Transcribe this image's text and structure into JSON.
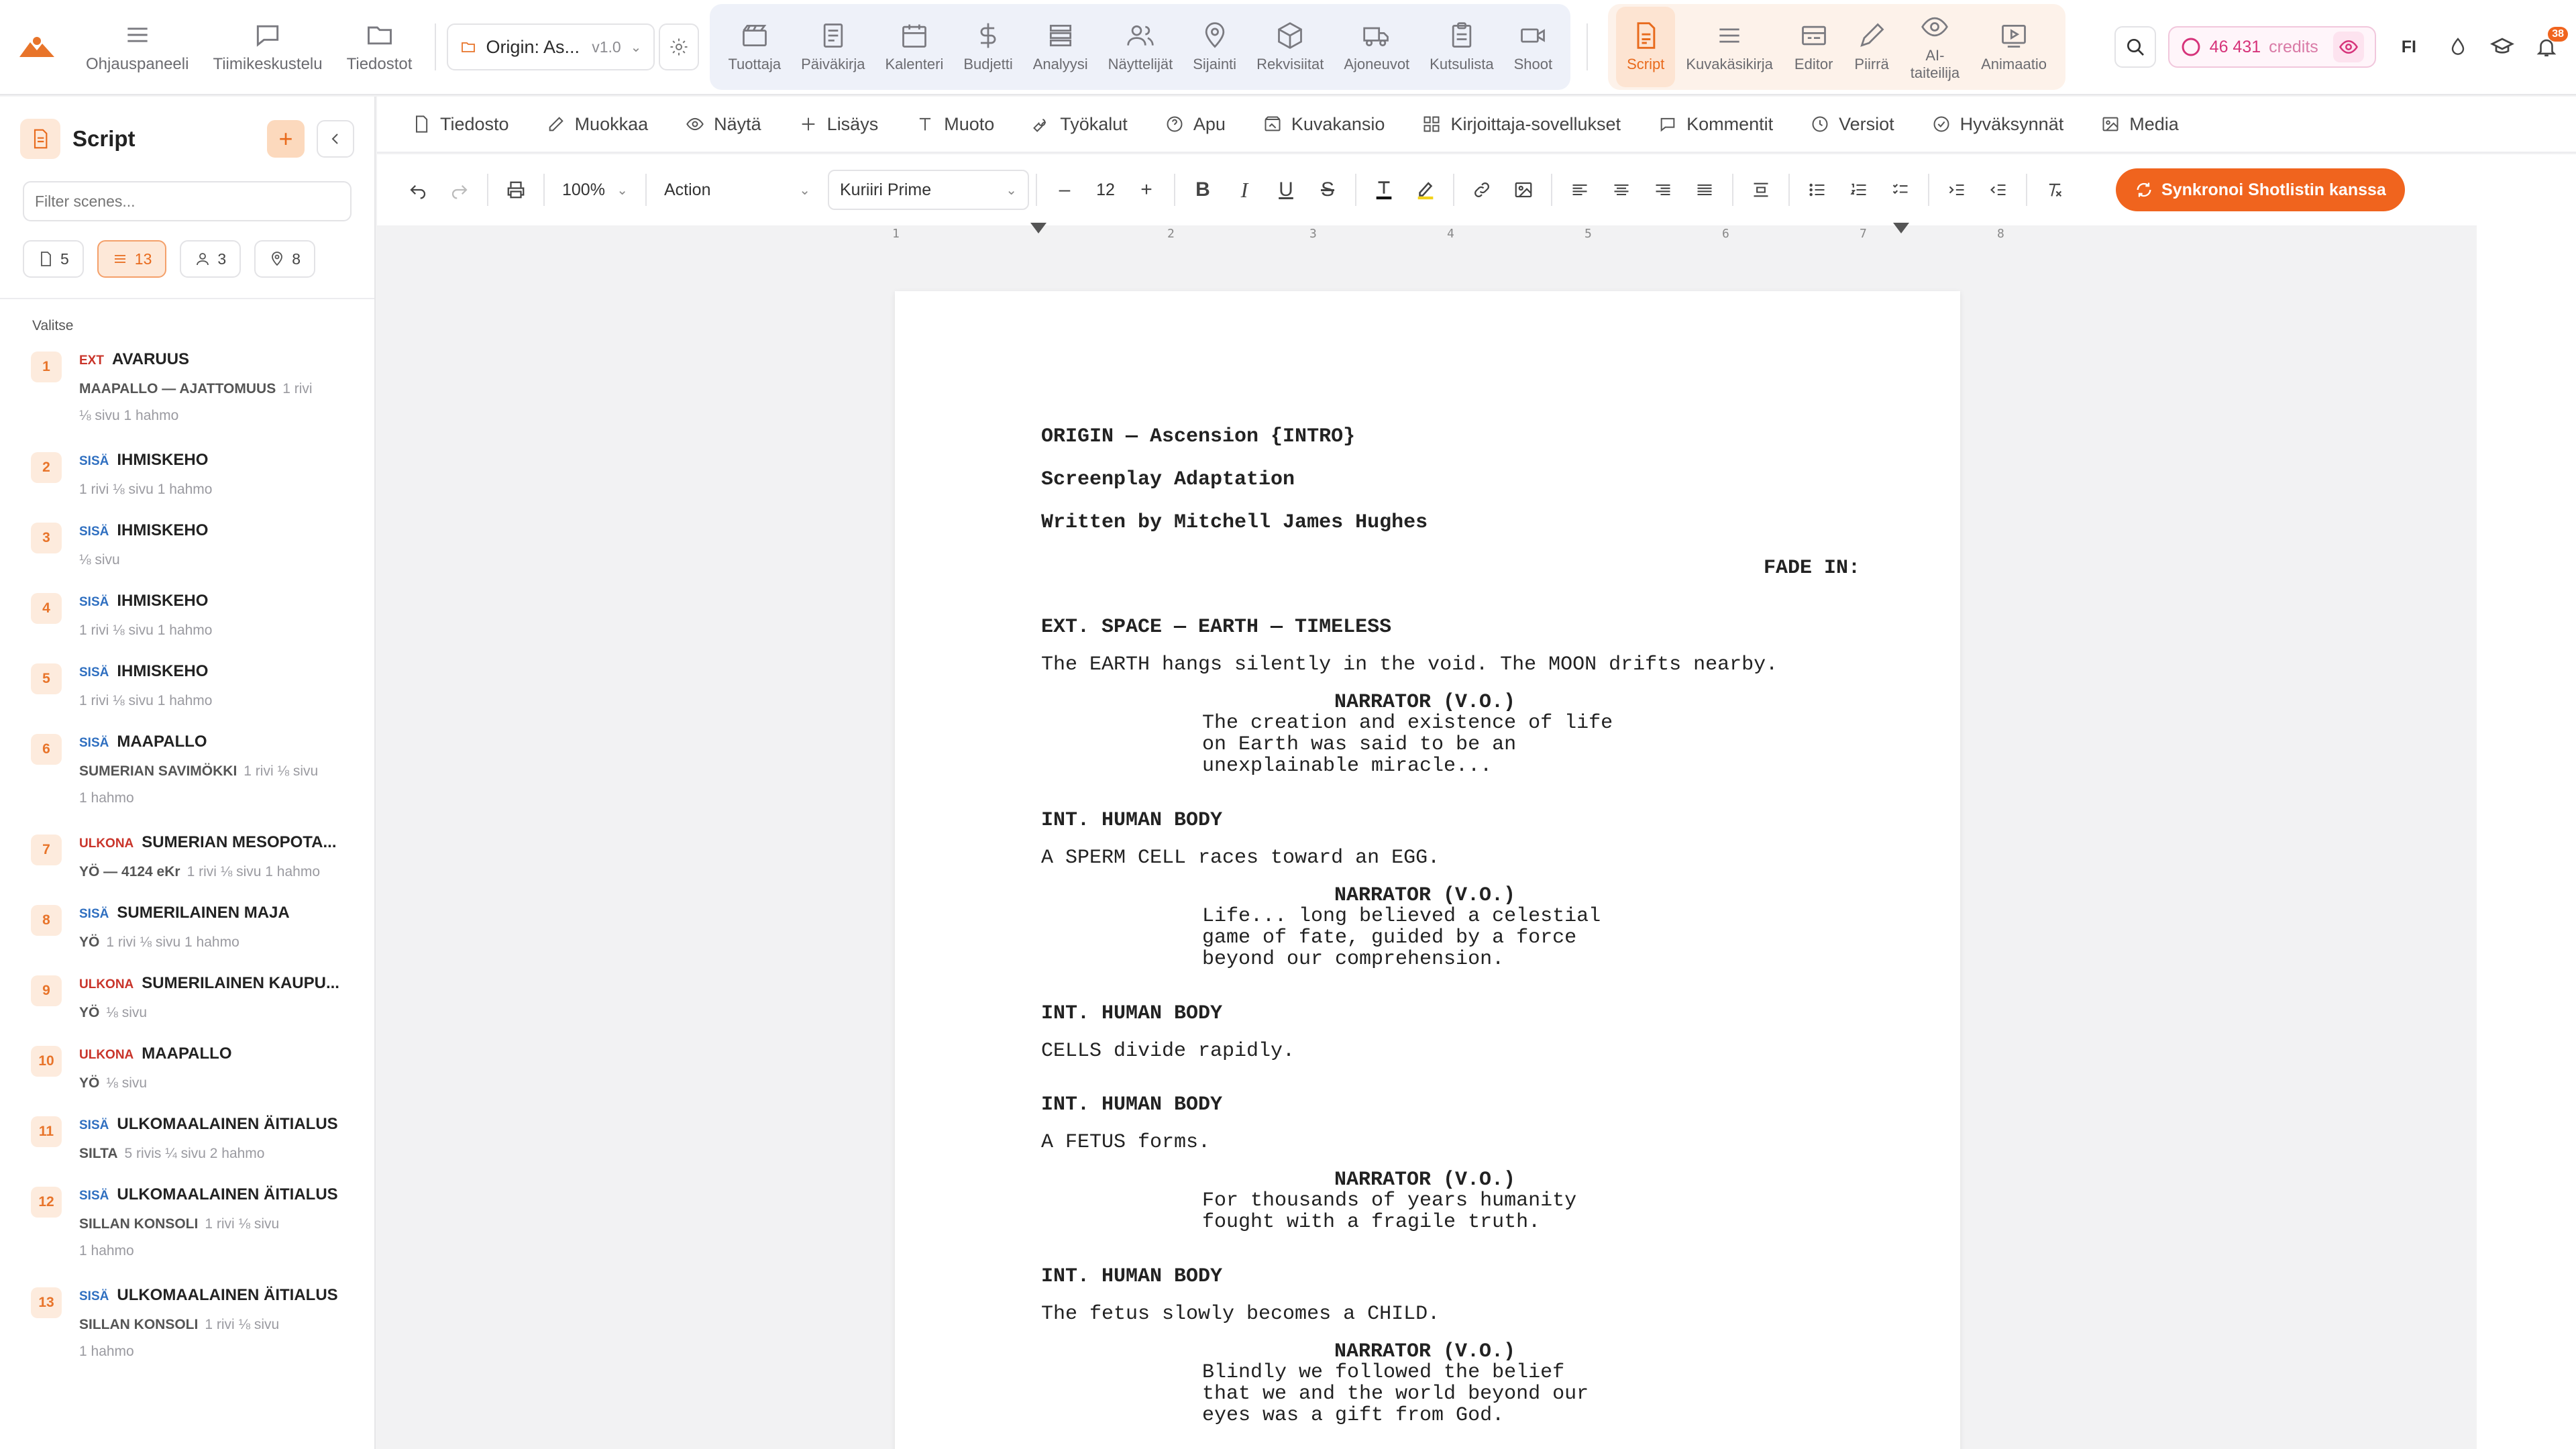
{
  "topbar": {
    "nav": [
      {
        "label": "Ohjauspaneeli",
        "icon": "dashboard-icon"
      },
      {
        "label": "Tiimikeskustelu",
        "icon": "chat-icon"
      },
      {
        "label": "Tiedostot",
        "icon": "folder-icon"
      }
    ],
    "project": {
      "name": "Origin: As...",
      "version": "v1.0"
    },
    "production_tools": [
      {
        "label": "Tuottaja",
        "icon": "clapper-icon"
      },
      {
        "label": "Päiväkirja",
        "icon": "journal-icon"
      },
      {
        "label": "Kalenteri",
        "icon": "calendar-icon"
      },
      {
        "label": "Budjetti",
        "icon": "dollar-icon"
      },
      {
        "label": "Analyysi",
        "icon": "layers-icon"
      },
      {
        "label": "Näyttelijät",
        "icon": "people-icon"
      },
      {
        "label": "Sijainti",
        "icon": "pin-icon"
      },
      {
        "label": "Rekvisiitat",
        "icon": "box-icon"
      },
      {
        "label": "Ajoneuvot",
        "icon": "truck-icon"
      },
      {
        "label": "Kutsulista",
        "icon": "clipboard-icon"
      },
      {
        "label": "Shoot",
        "icon": "camera-icon"
      }
    ],
    "creative_tools": [
      {
        "label": "Script",
        "icon": "script-icon",
        "active": true
      },
      {
        "label": "Kuvakäsikirja",
        "icon": "list-icon"
      },
      {
        "label": "Editor",
        "icon": "editor-icon"
      },
      {
        "label": "Piirrä",
        "icon": "pencil-icon"
      },
      {
        "label": "AI-\ntaiteilija",
        "icon": "eye-icon"
      },
      {
        "label": "Animaatio",
        "icon": "play-icon"
      }
    ],
    "credits": {
      "amount": "46 431",
      "unit": "credits"
    },
    "language": "FI",
    "notifications": "38"
  },
  "sidebar": {
    "title": "Script",
    "filter_placeholder": "Filter scenes...",
    "stats": [
      {
        "value": "5",
        "icon": "page-icon"
      },
      {
        "value": "13",
        "icon": "list-icon",
        "active": true
      },
      {
        "value": "3",
        "icon": "person-icon"
      },
      {
        "value": "8",
        "icon": "pin-icon"
      }
    ],
    "select_label": "Valitse",
    "scenes": [
      {
        "num": "1",
        "type": "EXT",
        "kind": "ext",
        "heading": "AVARUUS",
        "loc": "MAAPALLO — AJATTOMUUS",
        "meta1": "1 rivi",
        "meta2": "⅛ sivu  1 hahmo"
      },
      {
        "num": "2",
        "type": "SISÄ",
        "kind": "int",
        "heading": "IHMISKEHO",
        "loc": "",
        "meta1": "1 rivi  ⅛ sivu  1 hahmo",
        "meta2": ""
      },
      {
        "num": "3",
        "type": "SISÄ",
        "kind": "int",
        "heading": "IHMISKEHO",
        "loc": "",
        "meta1": "⅛ sivu",
        "meta2": ""
      },
      {
        "num": "4",
        "type": "SISÄ",
        "kind": "int",
        "heading": "IHMISKEHO",
        "loc": "",
        "meta1": "1 rivi  ⅛ sivu  1 hahmo",
        "meta2": ""
      },
      {
        "num": "5",
        "type": "SISÄ",
        "kind": "int",
        "heading": "IHMISKEHO",
        "loc": "",
        "meta1": "1 rivi  ⅛ sivu  1 hahmo",
        "meta2": ""
      },
      {
        "num": "6",
        "type": "SISÄ",
        "kind": "int",
        "heading": "MAAPALLO",
        "loc": "SUMERIAN SAVIMÖKKI",
        "meta1": "1 rivi  ⅛ sivu",
        "meta2": "1 hahmo"
      },
      {
        "num": "7",
        "type": "ULKONA",
        "kind": "ext",
        "heading": "SUMERIAN MESOPOTA...",
        "loc": "YÖ — 4124 eKr",
        "meta1": "1 rivi  ⅛ sivu  1 hahmo",
        "meta2": ""
      },
      {
        "num": "8",
        "type": "SISÄ",
        "kind": "int",
        "heading": "SUMERILAINEN MAJA",
        "loc": "YÖ",
        "meta1": "1 rivi  ⅛ sivu  1 hahmo",
        "meta2": ""
      },
      {
        "num": "9",
        "type": "ULKONA",
        "kind": "ext",
        "heading": "SUMERILAINEN KAUPU...",
        "loc": "YÖ",
        "meta1": "⅛ sivu",
        "meta2": ""
      },
      {
        "num": "10",
        "type": "ULKONA",
        "kind": "ext",
        "heading": "MAAPALLO",
        "loc": "YÖ",
        "meta1": "⅛ sivu",
        "meta2": ""
      },
      {
        "num": "11",
        "type": "SISÄ",
        "kind": "int",
        "heading": "ULKOMAALAINEN ÄITIALUS",
        "loc": "SILTA",
        "meta1": "5 rivis  ¼ sivu  2 hahmo",
        "meta2": ""
      },
      {
        "num": "12",
        "type": "SISÄ",
        "kind": "int",
        "heading": "ULKOMAALAINEN ÄITIALUS",
        "loc": "SILLAN KONSOLI",
        "meta1": "1 rivi  ⅛ sivu",
        "meta2": "1 hahmo"
      },
      {
        "num": "13",
        "type": "SISÄ",
        "kind": "int",
        "heading": "ULKOMAALAINEN ÄITIALUS",
        "loc": "SILLAN KONSOLI",
        "meta1": "1 rivi  ⅛ sivu",
        "meta2": "1 hahmo"
      }
    ]
  },
  "menubar": [
    {
      "label": "Tiedosto",
      "icon": "file-icon"
    },
    {
      "label": "Muokkaa",
      "icon": "edit-icon"
    },
    {
      "label": "Näytä",
      "icon": "eye-icon"
    },
    {
      "label": "Lisäys",
      "icon": "plus-icon"
    },
    {
      "label": "Muoto",
      "icon": "text-format-icon"
    },
    {
      "label": "Työkalut",
      "icon": "tools-icon"
    },
    {
      "label": "Apu",
      "icon": "help-icon"
    },
    {
      "label": "Kuvakansio",
      "icon": "image-folder-icon"
    },
    {
      "label": "Kirjoittaja-sovellukset",
      "icon": "apps-icon"
    },
    {
      "label": "Kommentit",
      "icon": "comment-icon"
    },
    {
      "label": "Versiot",
      "icon": "clock-icon"
    },
    {
      "label": "Hyväksynnät",
      "icon": "check-circle-icon"
    },
    {
      "label": "Media",
      "icon": "media-icon"
    }
  ],
  "toolbar": {
    "zoom": "100%",
    "element_type": "Action",
    "font": "Kuriiri Prime",
    "font_size": "12",
    "sync_label": "Synkronoi Shotlistin kanssa"
  },
  "ruler": [
    "1",
    "2",
    "3",
    "4",
    "5",
    "6",
    "7",
    "8"
  ],
  "script": {
    "title": "ORIGIN — Ascension {INTRO}",
    "subtitle": "Screenplay Adaptation",
    "author": "Written by Mitchell James Hughes",
    "fade_in": "FADE IN:",
    "blocks": [
      {
        "heading": "EXT. SPACE — EARTH — TIMELESS",
        "action": "The EARTH hangs silently in the void. The MOON drifts nearby.",
        "character": "NARRATOR (V.O.)",
        "dialogue": "The creation and existence of life\non Earth was said to be an\nunexplainable miracle..."
      },
      {
        "heading": "INT. HUMAN BODY",
        "action": "A SPERM CELL races toward an EGG.",
        "character": "NARRATOR (V.O.)",
        "dialogue": "Life... long believed a celestial\ngame of fate, guided by a force\nbeyond our comprehension."
      },
      {
        "heading": "INT. HUMAN BODY",
        "action": "CELLS divide rapidly.",
        "character": "",
        "dialogue": ""
      },
      {
        "heading": "INT. HUMAN BODY",
        "action": "A FETUS forms.",
        "character": "NARRATOR (V.O.)",
        "dialogue": "For thousands of years humanity\nfought with a fragile truth."
      },
      {
        "heading": "INT. HUMAN BODY",
        "action": "The fetus slowly becomes a CHILD.",
        "character": "NARRATOR (V.O.)",
        "dialogue": "Blindly we followed the belief\nthat we and the world beyond our\neyes was a gift from God."
      }
    ]
  }
}
